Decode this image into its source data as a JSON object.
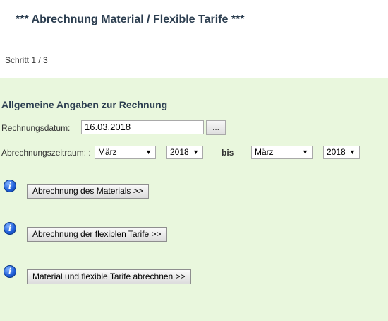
{
  "header": {
    "title": "*** Abrechnung Material / Flexible Tarife ***",
    "step": "Schritt 1 / 3"
  },
  "section": {
    "title": "Allgemeine Angaben zur Rechnung",
    "date_label": "Rechnungsdatum:",
    "date_value": "16.03.2018",
    "date_picker_label": "...",
    "period_label": "Abrechnungszeitraum: :",
    "from_month": "März",
    "from_year": "2018",
    "to_label": "bis",
    "to_month": "März",
    "to_year": "2018"
  },
  "actions": [
    {
      "label": "Abrechnung des Materials >>",
      "info_icon": "i"
    },
    {
      "label": "Abrechnung der flexiblen Tarife >>",
      "info_icon": "i"
    },
    {
      "label": "Material und flexible Tarife abrechnen >>",
      "info_icon": "i"
    }
  ],
  "colors": {
    "panel_bg": "#e9f7dd",
    "title_color": "#2c3e50"
  }
}
